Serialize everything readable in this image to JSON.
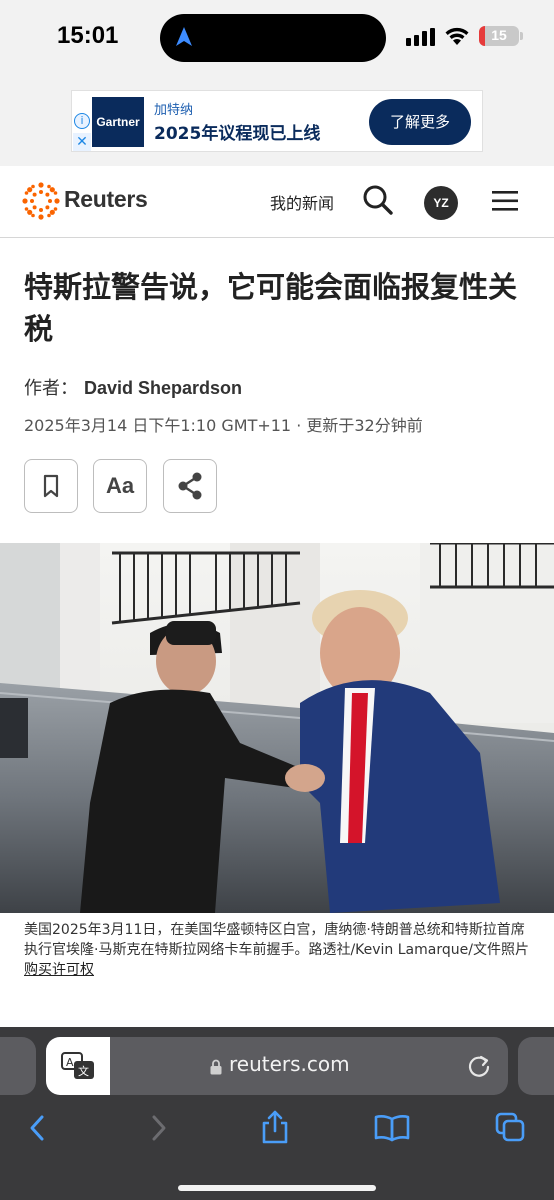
{
  "status_bar": {
    "time": "15:01",
    "battery": "15",
    "battery_level": 0.15
  },
  "ad": {
    "brand": "Gartner",
    "subtitle": "加特纳",
    "headline": "2025年议程现已上线",
    "cta": "了解更多",
    "info_icon": "info-icon",
    "close_icon": "close-icon"
  },
  "header": {
    "site_name": "Reuters",
    "my_news": "我的新闻",
    "avatar_initials": "YZ",
    "icons": [
      "search-icon",
      "menu-icon"
    ]
  },
  "article": {
    "title": "特斯拉警告说，它可能会面临报复性关税",
    "author_label": "作者：",
    "author": "David Shepardson",
    "dateline": "2025年3月14 日下午1:10 GMT+11 · 更新于32分钟前",
    "actions": {
      "bookmark_icon": "bookmark-icon",
      "font_size": "Aa",
      "share_icon": "share-icon"
    },
    "caption": "美国2025年3月11日，在美国华盛顿特区白宫，唐纳德·特朗普总统和特斯拉首席执行官埃隆·马斯克在特斯拉网络卡车前握手。路透社/Kevin Lamarque/文件照片",
    "license_link": "购买许可权"
  },
  "browser": {
    "url": "reuters.com",
    "accent_color": "#4a9df8",
    "toolbar_icons": [
      "back-icon",
      "forward-icon",
      "share-icon",
      "bookmarks-icon",
      "tabs-icon"
    ]
  }
}
